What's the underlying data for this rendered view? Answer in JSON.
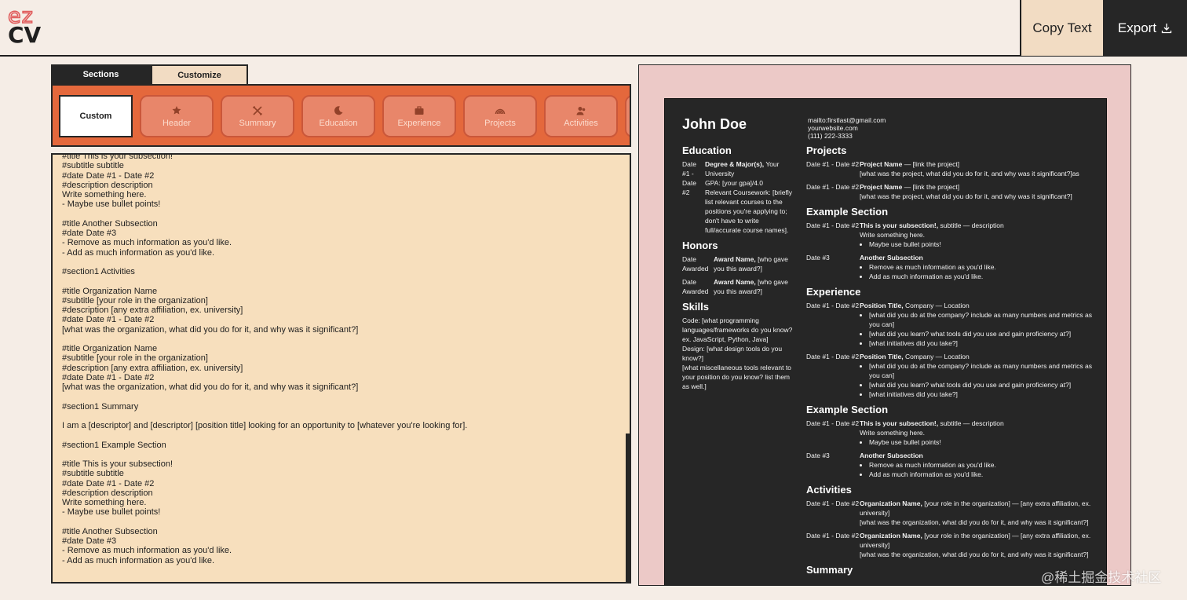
{
  "header": {
    "logo_top": "ez",
    "logo_bottom": "CV",
    "copy_label": "Copy Text",
    "export_label": "Export"
  },
  "tabs": [
    {
      "label": "Sections",
      "active": true
    },
    {
      "label": "Customize",
      "active": false
    }
  ],
  "sections": [
    {
      "label": "Custom",
      "icon": "none",
      "active": true
    },
    {
      "label": "Header",
      "icon": "star-badge-icon"
    },
    {
      "label": "Summary",
      "icon": "tools-icon"
    },
    {
      "label": "Education",
      "icon": "moon-icon"
    },
    {
      "label": "Experience",
      "icon": "briefcase-icon"
    },
    {
      "label": "Projects",
      "icon": "rainbow-icon"
    },
    {
      "label": "Activities",
      "icon": "people-icon"
    }
  ],
  "editor_text": "#title This is your subsection!\n#subtitle subtitle\n#date Date #1 - Date #2\n#description description\nWrite something here.\n- Maybe use bullet points!\n\n#title Another Subsection\n#date Date #3\n- Remove as much information as you'd like.\n- Add as much information as you'd like.\n\n#section1 Activities\n\n#title Organization Name\n#subtitle [your role in the organization]\n#description [any extra affiliation, ex. university]\n#date Date #1 - Date #2\n[what was the organization, what did you do for it, and why was it significant?]\n\n#title Organization Name\n#subtitle [your role in the organization]\n#description [any extra affiliation, ex. university]\n#date Date #1 - Date #2\n[what was the organization, what did you do for it, and why was it significant?]\n\n#section1 Summary\n\nI am a [descriptor] and [descriptor] [position title] looking for an opportunity to [whatever you're looking for].\n\n#section1 Example Section\n\n#title This is your subsection!\n#subtitle subtitle\n#date Date #1 - Date #2\n#description description\nWrite something here.\n- Maybe use bullet points!\n\n#title Another Subsection\n#date Date #3\n- Remove as much information as you'd like.\n- Add as much information as you'd like.",
  "resume": {
    "name": "John Doe",
    "contact": [
      "mailto:firstlast@gmail.com",
      "yourwebsite.com",
      "(111) 222-3333"
    ],
    "education": {
      "heading": "Education",
      "date": "Date #1 - Date #2",
      "degree": "Degree & Major(s),",
      "school": " Your University",
      "gpa": "GPA: [your gpa]/4.0",
      "coursework": "Relevant Coursework: [briefly list relevant courses to the positions you're applying to; don't have to write full/accurate course names]."
    },
    "honors": {
      "heading": "Honors",
      "items": [
        {
          "date": "Date Awarded",
          "name": "Award Name,",
          "desc": " [who gave you this award?]"
        },
        {
          "date": "Date Awarded",
          "name": "Award Name,",
          "desc": " [who gave you this award?]"
        }
      ]
    },
    "skills": {
      "heading": "Skills",
      "text": "Code: [what programming languages/frameworks do you know? ex. JavaScript, Python, Java]\nDesign: [what design tools do you know?]\n[what miscellaneous tools relevant to your position do you know? list them as well.]"
    },
    "projects": {
      "heading": "Projects",
      "items": [
        {
          "date": "Date #1 - Date #2",
          "title": "Project Name",
          "rest": " — [link the project]",
          "desc": "[what was the project, what did you do for it, and why was it significant?]as"
        },
        {
          "date": "Date #1 - Date #2",
          "title": "Project Name",
          "rest": " — [link the project]",
          "desc": "[what was the project, what did you do for it, and why was it significant?]"
        }
      ]
    },
    "example1": {
      "heading": "Example Section",
      "items": [
        {
          "date": "Date #1 - Date #2",
          "title": "This is your subsection!,",
          "rest": " subtitle — description",
          "desc": "Write something here.",
          "bullets": [
            "Maybe use bullet points!"
          ]
        },
        {
          "date": "Date #3",
          "title": "Another Subsection",
          "rest": "",
          "desc": "",
          "bullets": [
            "Remove as much information as you'd like.",
            "Add as much information as you'd like."
          ]
        }
      ]
    },
    "experience": {
      "heading": "Experience",
      "items": [
        {
          "date": "Date #1 - Date #2",
          "title": "Position Title,",
          "rest": " Company — Location",
          "bullets": [
            "[what did you do at the company? include as many numbers and metrics as you can]",
            "[what did you learn? what tools did you use and gain proficiency at?]",
            "[what initiatives did you take?]"
          ]
        },
        {
          "date": "Date #1 - Date #2",
          "title": "Position Title,",
          "rest": " Company — Location",
          "bullets": [
            "[what did you do at the company? include as many numbers and metrics as you can]",
            "[what did you learn? what tools did you use and gain proficiency at?]",
            "[what initiatives did you take?]"
          ]
        }
      ]
    },
    "example2": {
      "heading": "Example Section",
      "items": [
        {
          "date": "Date #1 - Date #2",
          "title": "This is your subsection!,",
          "rest": " subtitle — description",
          "desc": "Write something here.",
          "bullets": [
            "Maybe use bullet points!"
          ]
        },
        {
          "date": "Date #3",
          "title": "Another Subsection",
          "rest": "",
          "desc": "",
          "bullets": [
            "Remove as much information as you'd like.",
            "Add as much information as you'd like."
          ]
        }
      ]
    },
    "activities": {
      "heading": "Activities",
      "items": [
        {
          "date": "Date #1 - Date #2",
          "title": "Organization Name,",
          "rest": " [your role in the organization] — [any extra affiliation, ex. university]",
          "desc": "[what was the organization, what did you do for it, and why was it significant?]"
        },
        {
          "date": "Date #1 - Date #2",
          "title": "Organization Name,",
          "rest": " [your role in the organization] — [any extra affiliation, ex. university]",
          "desc": "[what was the organization, what did you do for it, and why was it significant?]"
        }
      ]
    },
    "summary_heading": "Summary"
  },
  "watermark": "@稀土掘金技术社区",
  "colors": {
    "background": "#f5ede6",
    "dark": "#262626",
    "accent_orange": "#e4683c",
    "editor_bg": "#f7dfbd",
    "preview_bg": "#ecc9c7",
    "copy_bg": "#f2dcc3",
    "logo_red": "#e05c5c"
  }
}
